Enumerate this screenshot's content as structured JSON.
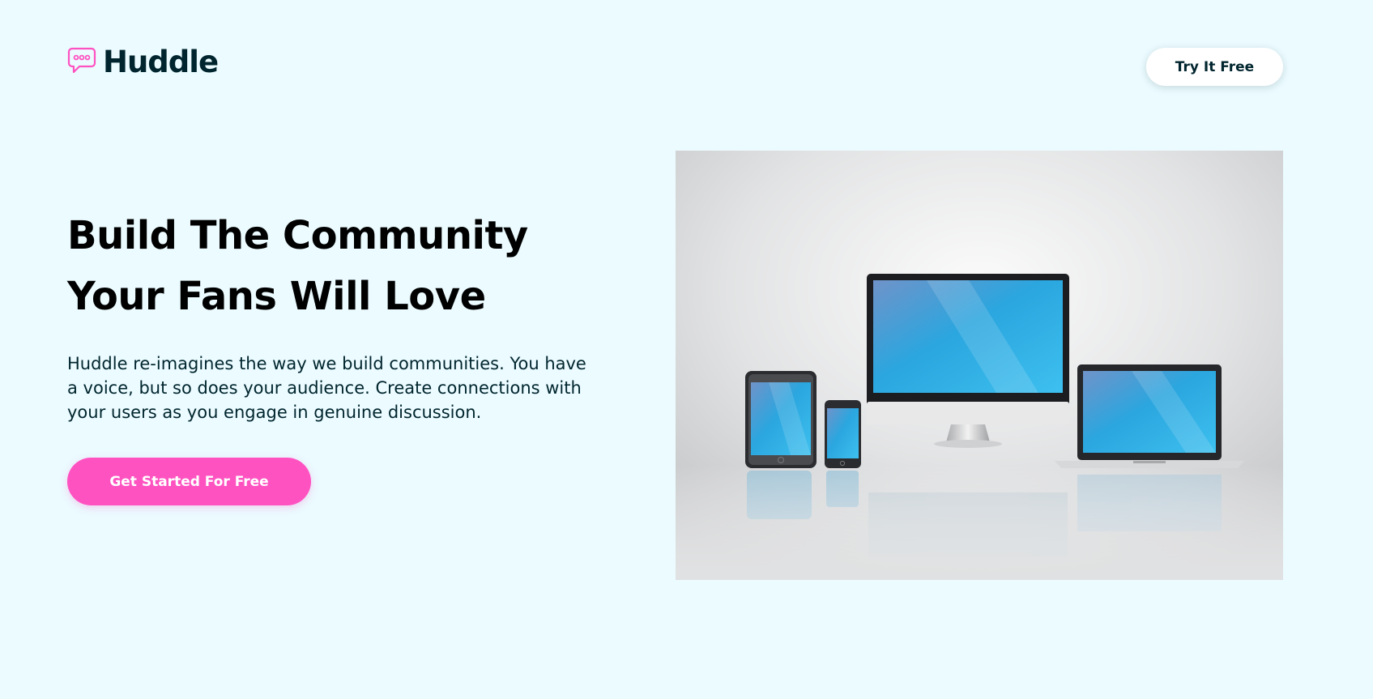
{
  "header": {
    "logo_text": "Huddle",
    "logo_icon": "speech-bubble-icon",
    "try_button_label": "Try It Free"
  },
  "hero": {
    "title_line_1": "Build The Community",
    "title_line_2": "Your Fans Will Love",
    "description": "Huddle re-imagines the way we build communities. You have a voice, but so does your audience. Create connections with your users as you engage in genuine discussion.",
    "cta_label": "Get Started For Free"
  },
  "illustration": {
    "name": "devices-illustration",
    "devices": [
      "tablet",
      "phone",
      "desktop-monitor",
      "laptop"
    ]
  },
  "colors": {
    "background": "#ebfbff",
    "heading": "#00252e",
    "accent_pink": "#ff52c1",
    "button_white": "#ffffff"
  }
}
